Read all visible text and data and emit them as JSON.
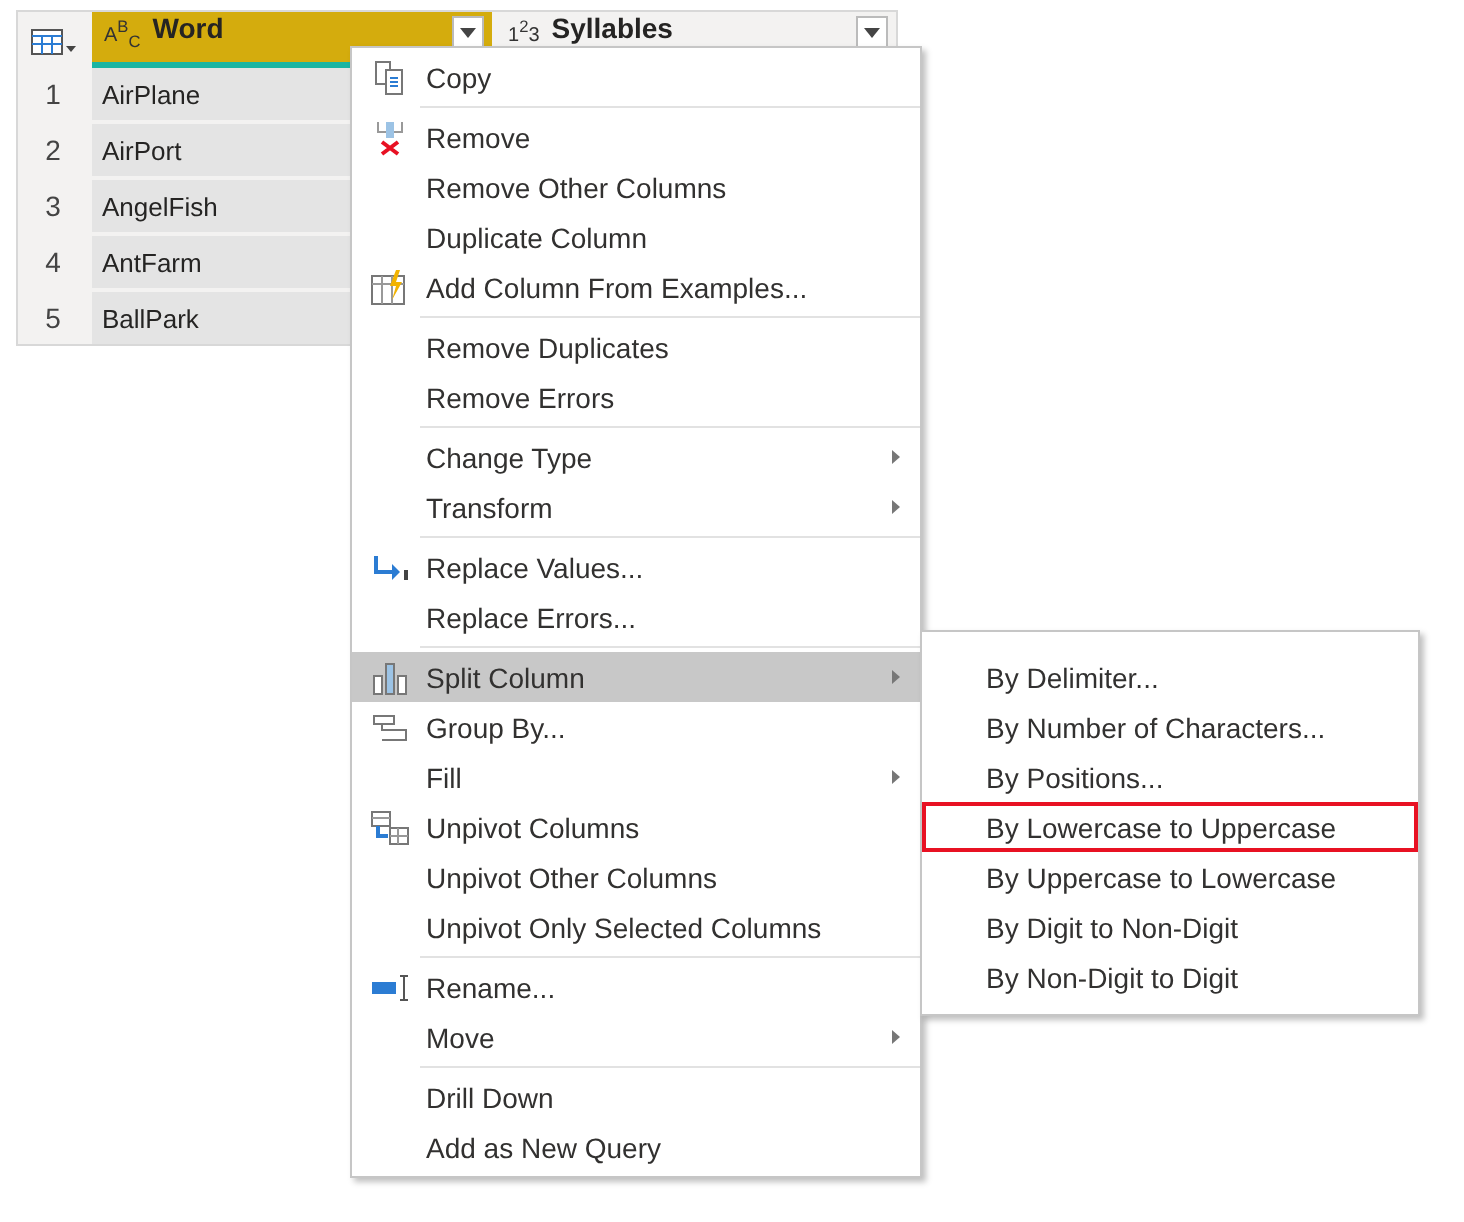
{
  "table": {
    "columns": [
      {
        "type_label": "A$^{B}$$_{C}$",
        "title": "Word",
        "selected": true
      },
      {
        "type_label": "1$^{2}$3",
        "title": "Syllables",
        "selected": false
      }
    ],
    "rows": [
      {
        "number": "1",
        "word": "AirPlane"
      },
      {
        "number": "2",
        "word": "AirPort"
      },
      {
        "number": "3",
        "word": "AngelFish"
      },
      {
        "number": "4",
        "word": "AntFarm"
      },
      {
        "number": "5",
        "word": "BallPark"
      }
    ]
  },
  "context_menu": {
    "groups": [
      [
        {
          "label": "Copy",
          "submenu": false,
          "selected": false
        }
      ],
      [
        {
          "label": "Remove",
          "submenu": false,
          "selected": false
        },
        {
          "label": "Remove Other Columns",
          "submenu": false,
          "selected": false
        },
        {
          "label": "Duplicate Column",
          "submenu": false,
          "selected": false
        },
        {
          "label": "Add Column From Examples...",
          "submenu": false,
          "selected": false
        }
      ],
      [
        {
          "label": "Remove Duplicates",
          "submenu": false,
          "selected": false
        },
        {
          "label": "Remove Errors",
          "submenu": false,
          "selected": false
        }
      ],
      [
        {
          "label": "Change Type",
          "submenu": true,
          "selected": false
        },
        {
          "label": "Transform",
          "submenu": true,
          "selected": false
        }
      ],
      [
        {
          "label": "Replace Values...",
          "submenu": false,
          "selected": false
        },
        {
          "label": "Replace Errors...",
          "submenu": false,
          "selected": false
        }
      ],
      [
        {
          "label": "Split Column",
          "submenu": true,
          "selected": true
        },
        {
          "label": "Group By...",
          "submenu": false,
          "selected": false
        },
        {
          "label": "Fill",
          "submenu": true,
          "selected": false
        },
        {
          "label": "Unpivot Columns",
          "submenu": false,
          "selected": false
        },
        {
          "label": "Unpivot Other Columns",
          "submenu": false,
          "selected": false
        },
        {
          "label": "Unpivot Only Selected Columns",
          "submenu": false,
          "selected": false
        }
      ],
      [
        {
          "label": "Rename...",
          "submenu": false,
          "selected": false
        },
        {
          "label": "Move",
          "submenu": true,
          "selected": false
        }
      ],
      [
        {
          "label": "Drill Down",
          "submenu": false,
          "selected": false
        },
        {
          "label": "Add as New Query",
          "submenu": false,
          "selected": false
        }
      ]
    ]
  },
  "split_submenu": {
    "items": [
      {
        "label": "By Delimiter...",
        "highlighted": false
      },
      {
        "label": "By Number of Characters...",
        "highlighted": false
      },
      {
        "label": "By Positions...",
        "highlighted": false
      },
      {
        "label": "By Lowercase to Uppercase",
        "highlighted": true
      },
      {
        "label": "By Uppercase to Lowercase",
        "highlighted": false
      },
      {
        "label": "By Digit to Non-Digit",
        "highlighted": false
      },
      {
        "label": "By Non-Digit to Digit",
        "highlighted": false
      }
    ]
  }
}
